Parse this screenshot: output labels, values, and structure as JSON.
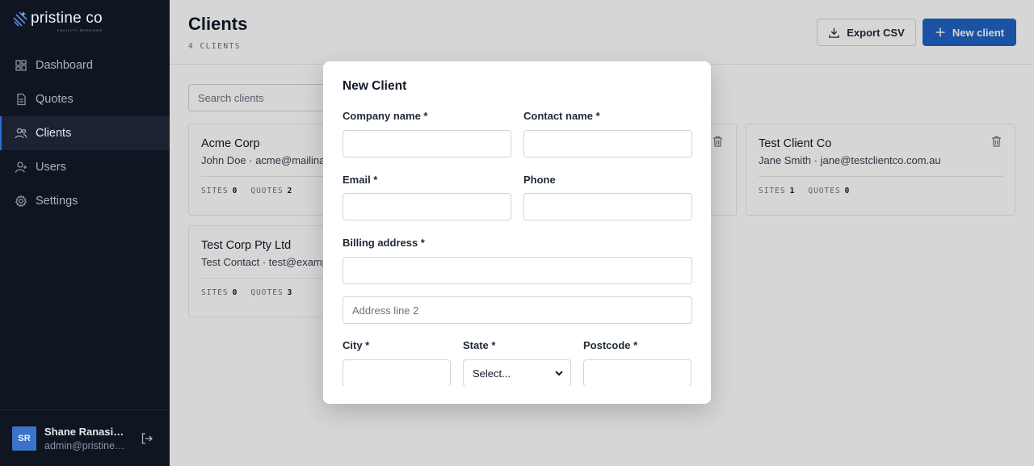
{
  "brand": {
    "name": "pristine co",
    "tagline": "FACILITY SERVICES"
  },
  "nav": {
    "items": [
      {
        "label": "Dashboard",
        "icon": "dashboard-icon"
      },
      {
        "label": "Quotes",
        "icon": "document-icon"
      },
      {
        "label": "Clients",
        "icon": "users-icon",
        "active": true
      },
      {
        "label": "Users",
        "icon": "user-icon"
      },
      {
        "label": "Settings",
        "icon": "gear-icon"
      }
    ]
  },
  "user": {
    "initials": "SR",
    "name": "Shane Ranasinghe",
    "email": "admin@pristineco.com.au"
  },
  "header": {
    "title": "Clients",
    "subtitle": "4 CLIENTS",
    "export_label": "Export CSV",
    "new_label": "New client"
  },
  "search": {
    "placeholder": "Search clients"
  },
  "clients": [
    {
      "name": "Acme Corp",
      "contact": "John Doe · acme@mailinator.com",
      "sites_label": "SITES",
      "sites": "0",
      "quotes_label": "QUOTES",
      "quotes": "2"
    },
    {
      "name": "Test Client Co",
      "contact": "Jane Smith · jane@testclientco.com.au",
      "sites_label": "SITES",
      "sites": "1",
      "quotes_label": "QUOTES",
      "quotes": "0"
    },
    {
      "name": "Test Corp Pty Ltd",
      "contact": "Test Contact · test@example.com",
      "sites_label": "SITES",
      "sites": "0",
      "quotes_label": "QUOTES",
      "quotes": "3"
    }
  ],
  "modal": {
    "title": "New Client",
    "company_label": "Company name *",
    "contact_label": "Contact name *",
    "email_label": "Email *",
    "phone_label": "Phone",
    "billing_label": "Billing address *",
    "address2_placeholder": "Address line 2",
    "city_label": "City *",
    "state_label": "State *",
    "state_value": "Select...",
    "postcode_label": "Postcode *"
  },
  "colors": {
    "sidebar": "#0f1521",
    "accent": "#1f64c4"
  }
}
